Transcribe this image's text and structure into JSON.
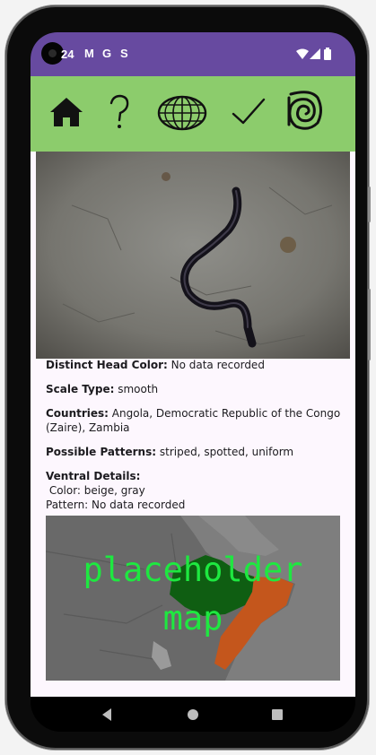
{
  "status_bar": {
    "time": "24",
    "notifications": [
      "M",
      "G",
      "S"
    ]
  },
  "toolbar": {
    "items": [
      {
        "icon": "home-icon"
      },
      {
        "icon": "help-icon"
      },
      {
        "icon": "globe-icon"
      },
      {
        "icon": "checkmark-icon"
      },
      {
        "icon": "spiral-icon"
      }
    ],
    "background": "#8ccc6c"
  },
  "details": {
    "head_color": {
      "label": "Distinct Head Color:",
      "value": " No data recorded"
    },
    "scale_type": {
      "label": "Scale Type:",
      "value": " smooth"
    },
    "countries": {
      "label": "Countries:",
      "value": " Angola, Democratic Republic of the Congo (Zaire), Zambia"
    },
    "patterns": {
      "label": "Possible Patterns:",
      "value": " striped, spotted, uniform"
    },
    "ventral": {
      "label": "Ventral Details:",
      "color_line": " Color: beige, gray",
      "pattern_line": "Pattern: No data recorded"
    }
  },
  "map": {
    "label": "placeholder\nmap"
  },
  "colors": {
    "status_bar": "#674aa0",
    "map_text": "#1ee840"
  }
}
